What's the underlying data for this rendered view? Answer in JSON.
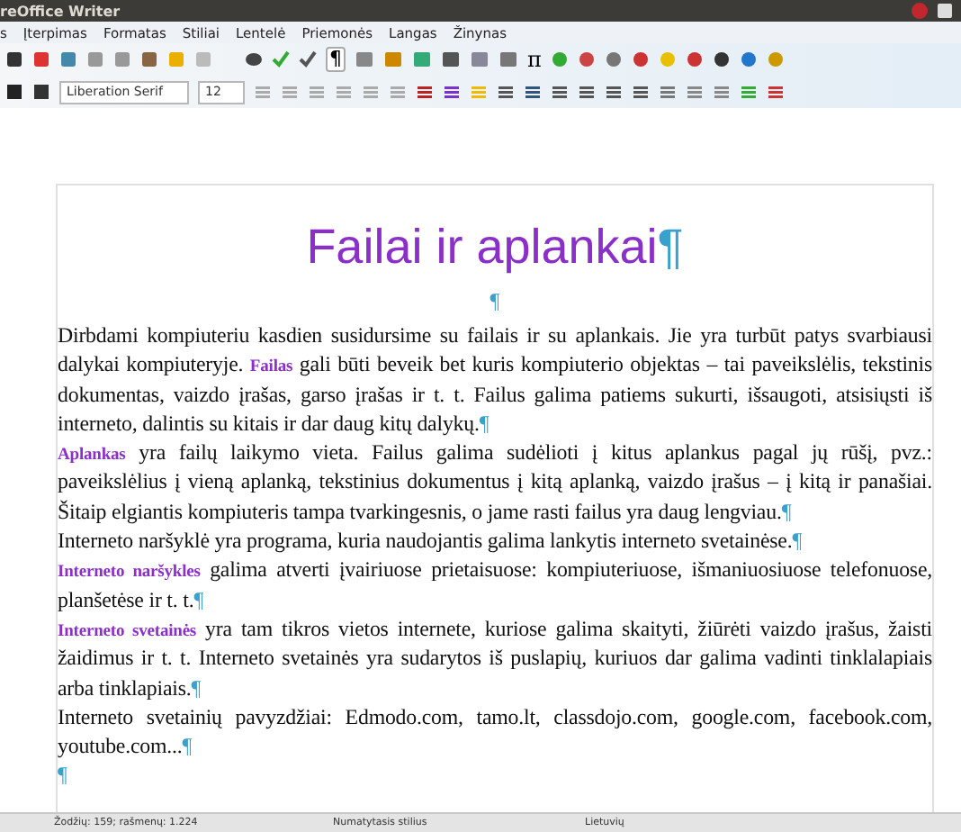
{
  "window": {
    "title": "reOffice Writer"
  },
  "menu": [
    "s",
    "Įterpimas",
    "Formatas",
    "Stiliai",
    "Lentelė",
    "Priemonės",
    "Langas",
    "Žinynas"
  ],
  "toolbar": {
    "paragraph_glyph": "¶",
    "pi_glyph": "π",
    "font": "Liberation Serif",
    "size": "12"
  },
  "document": {
    "title": "Failai ir aplankai",
    "title_mark": "¶",
    "after_title_mark": "¶",
    "paragraphs": [
      {
        "runs": [
          {
            "kind": "text",
            "text": "Dirbdami kompiuteriu kasdien susidursime su failais ir su aplankais. Jie yra turbūt patys svarbiausi dalykai kompiuteryje. "
          },
          {
            "kind": "term",
            "text": "Failas"
          },
          {
            "kind": "text",
            "text": " gali būti beveik bet kuris kompiuterio objektas – tai paveikslėlis, tekstinis dokumentas, vaizdo įrašas, garso įrašas ir t. t. Failus galima patiems sukurti, išsaugoti, atsisiųsti iš interneto, dalintis su kitais ir dar daug kitų dalykų."
          }
        ],
        "mark": "¶"
      },
      {
        "runs": [
          {
            "kind": "term",
            "text": "Aplankas"
          },
          {
            "kind": "text",
            "text": " yra failų laikymo vieta. Failus galima sudėlioti į kitus aplankus pagal jų rūšį, pvz.: paveikslėlius į vieną aplanką, tekstinius dokumentus į kitą aplanką, vaizdo įrašus – į kitą ir panašiai. Šitaip elgiantis kompiuteris tampa tvarkingesnis, o jame rasti failus yra daug lengviau."
          }
        ],
        "mark": "¶"
      },
      {
        "runs": [
          {
            "kind": "text",
            "text": "Interneto naršyklė yra programa, kuria naudojantis galima lankytis interneto svetainėse."
          }
        ],
        "mark": "¶"
      },
      {
        "runs": [
          {
            "kind": "term",
            "text": "Interneto naršykles"
          },
          {
            "kind": "text",
            "text": " galima atverti įvairiuose prietaisuose: kompiuteriuose, išmaniuosiuose telefonuose, planšetėse ir t. t."
          }
        ],
        "mark": "¶"
      },
      {
        "runs": [
          {
            "kind": "term",
            "text": "Interneto svetainės"
          },
          {
            "kind": "text",
            "text": " yra tam tikros vietos internete, kuriose galima skaityti, žiūrėti vaizdo įrašus, žaisti žaidimus ir t. t. Interneto svetainės yra sudarytos iš puslapių, kuriuos dar galima vadinti tinklalapiais arba tinklapiais."
          }
        ],
        "mark": "¶"
      },
      {
        "runs": [
          {
            "kind": "text",
            "text": "Interneto svetainių pavyzdžiai: Edmodo.com, tamo.lt, classdojo.com, google.com, facebook.com, youtube.com..."
          }
        ],
        "mark": "¶"
      },
      {
        "mark": "¶"
      }
    ]
  },
  "status_bar": {
    "words": "Žodžių: 159; rašmenų: 1.224",
    "style": "Numatytasis stilius",
    "language": "Lietuvių"
  }
}
